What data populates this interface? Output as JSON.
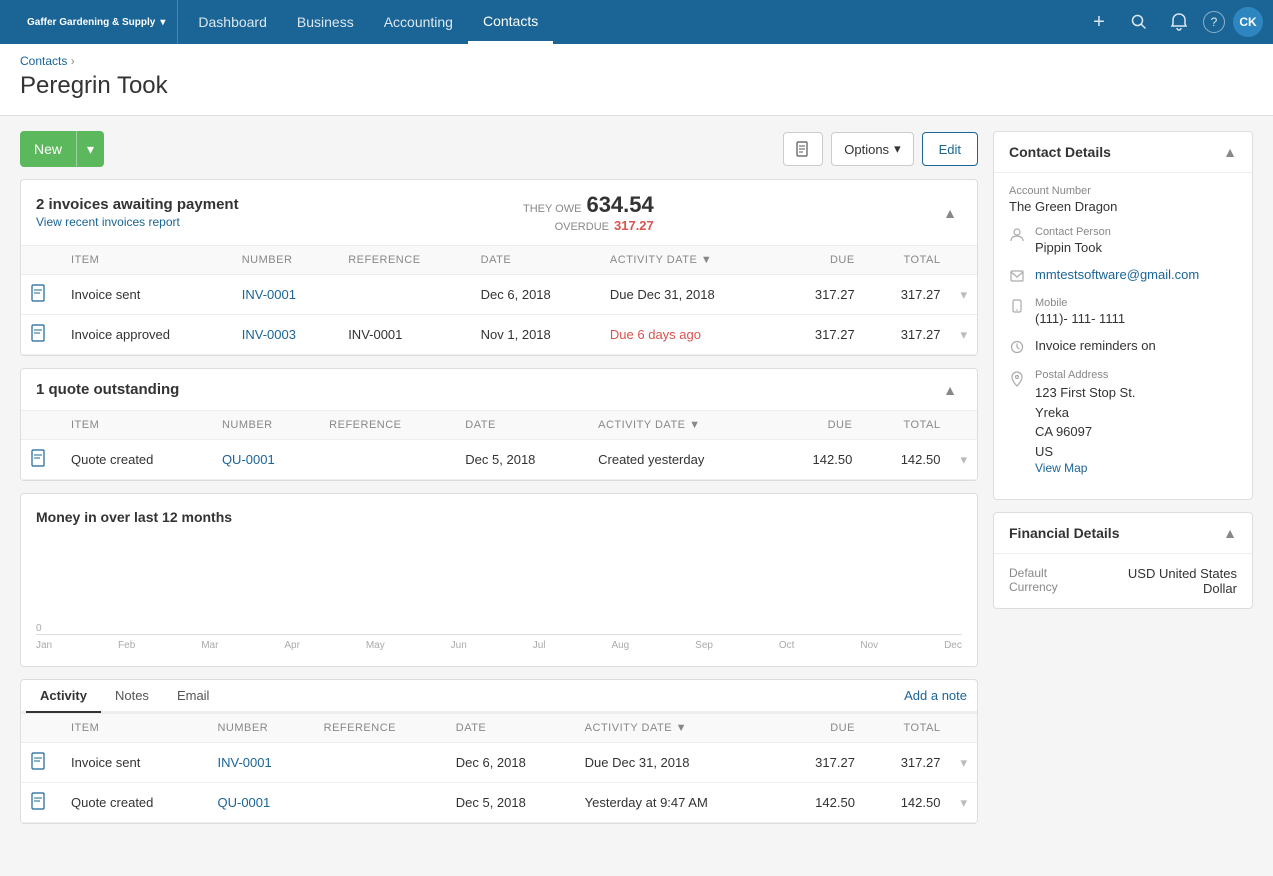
{
  "app": {
    "brand": "Gaffer Gardening & Supply",
    "dropdown_arrow": "▾"
  },
  "nav": {
    "links": [
      {
        "id": "dashboard",
        "label": "Dashboard",
        "active": false
      },
      {
        "id": "business",
        "label": "Business",
        "active": false
      },
      {
        "id": "accounting",
        "label": "Accounting",
        "active": false
      },
      {
        "id": "contacts",
        "label": "Contacts",
        "active": true
      }
    ],
    "icons": {
      "plus": "+",
      "search": "🔍",
      "bell": "🔔",
      "help": "?",
      "avatar": "CK"
    }
  },
  "breadcrumb": {
    "parent": "Contacts",
    "separator": "›"
  },
  "page_title": "Peregrin Took",
  "toolbar": {
    "new_label": "New",
    "options_label": "Options",
    "edit_label": "Edit"
  },
  "invoices_section": {
    "title": "2 invoices awaiting payment",
    "subtitle": "View recent invoices report",
    "they_owe_label": "THEY OWE",
    "they_owe_amount": "634.54",
    "overdue_label": "OVERDUE",
    "overdue_amount": "317.27",
    "columns": [
      "ITEM",
      "NUMBER",
      "REFERENCE",
      "DATE",
      "ACTIVITY DATE ▼",
      "DUE",
      "TOTAL"
    ],
    "rows": [
      {
        "item": "Invoice sent",
        "number": "INV-0001",
        "reference": "",
        "date": "Dec 6, 2018",
        "activity_date": "Due Dec 31, 2018",
        "activity_date_class": "",
        "due": "317.27",
        "total": "317.27"
      },
      {
        "item": "Invoice approved",
        "number": "INV-0003",
        "reference": "INV-0001",
        "date": "Nov 1, 2018",
        "activity_date": "Due 6 days ago",
        "activity_date_class": "due-red",
        "due": "317.27",
        "total": "317.27"
      }
    ]
  },
  "quotes_section": {
    "title": "1 quote outstanding",
    "columns": [
      "ITEM",
      "NUMBER",
      "REFERENCE",
      "DATE",
      "ACTIVITY DATE ▼",
      "DUE",
      "TOTAL"
    ],
    "rows": [
      {
        "item": "Quote created",
        "number": "QU-0001",
        "reference": "",
        "date": "Dec 5, 2018",
        "activity_date": "Created yesterday",
        "activity_date_class": "",
        "due": "142.50",
        "total": "142.50"
      }
    ]
  },
  "chart": {
    "title": "Money in over last 12 months",
    "zero_label": "0",
    "x_labels": [
      "Jan",
      "Feb",
      "Mar",
      "Apr",
      "May",
      "Jun",
      "Jul",
      "Aug",
      "Sep",
      "Oct",
      "Nov",
      "Dec"
    ]
  },
  "activity": {
    "tabs": [
      "Activity",
      "Notes",
      "Email"
    ],
    "active_tab": "Activity",
    "add_note_label": "Add a note",
    "columns": [
      "ITEM",
      "NUMBER",
      "REFERENCE",
      "DATE",
      "ACTIVITY DATE ▼",
      "DUE",
      "TOTAL"
    ],
    "rows": [
      {
        "item": "Invoice sent",
        "number": "INV-0001",
        "reference": "",
        "date": "Dec 6, 2018",
        "activity_date": "Due Dec 31, 2018",
        "activity_date_class": "",
        "due": "317.27",
        "total": "317.27"
      },
      {
        "item": "Quote created",
        "number": "QU-0001",
        "reference": "",
        "date": "Dec 5, 2018",
        "activity_date": "Yesterday at 9:47 AM",
        "activity_date_class": "",
        "due": "142.50",
        "total": "142.50"
      }
    ]
  },
  "contact_details": {
    "title": "Contact Details",
    "account_number_label": "Account Number",
    "account_number_value": "The Green Dragon",
    "contact_person_label": "Contact Person",
    "contact_person_value": "Pippin  Took",
    "email_value": "mmtestsoftware@gmail.com",
    "mobile_label": "Mobile",
    "mobile_value": "(111)- 111- 1111",
    "invoice_reminders_label": "Invoice reminders on",
    "postal_address_label": "Postal Address",
    "address_line1": "123 First Stop St.",
    "address_line2": "Yreka",
    "address_line3": "CA 96097",
    "address_line4": "US",
    "view_map_label": "View Map"
  },
  "financial_details": {
    "title": "Financial Details",
    "default_currency_label": "Default Currency",
    "default_currency_value": "USD United States Dollar"
  }
}
